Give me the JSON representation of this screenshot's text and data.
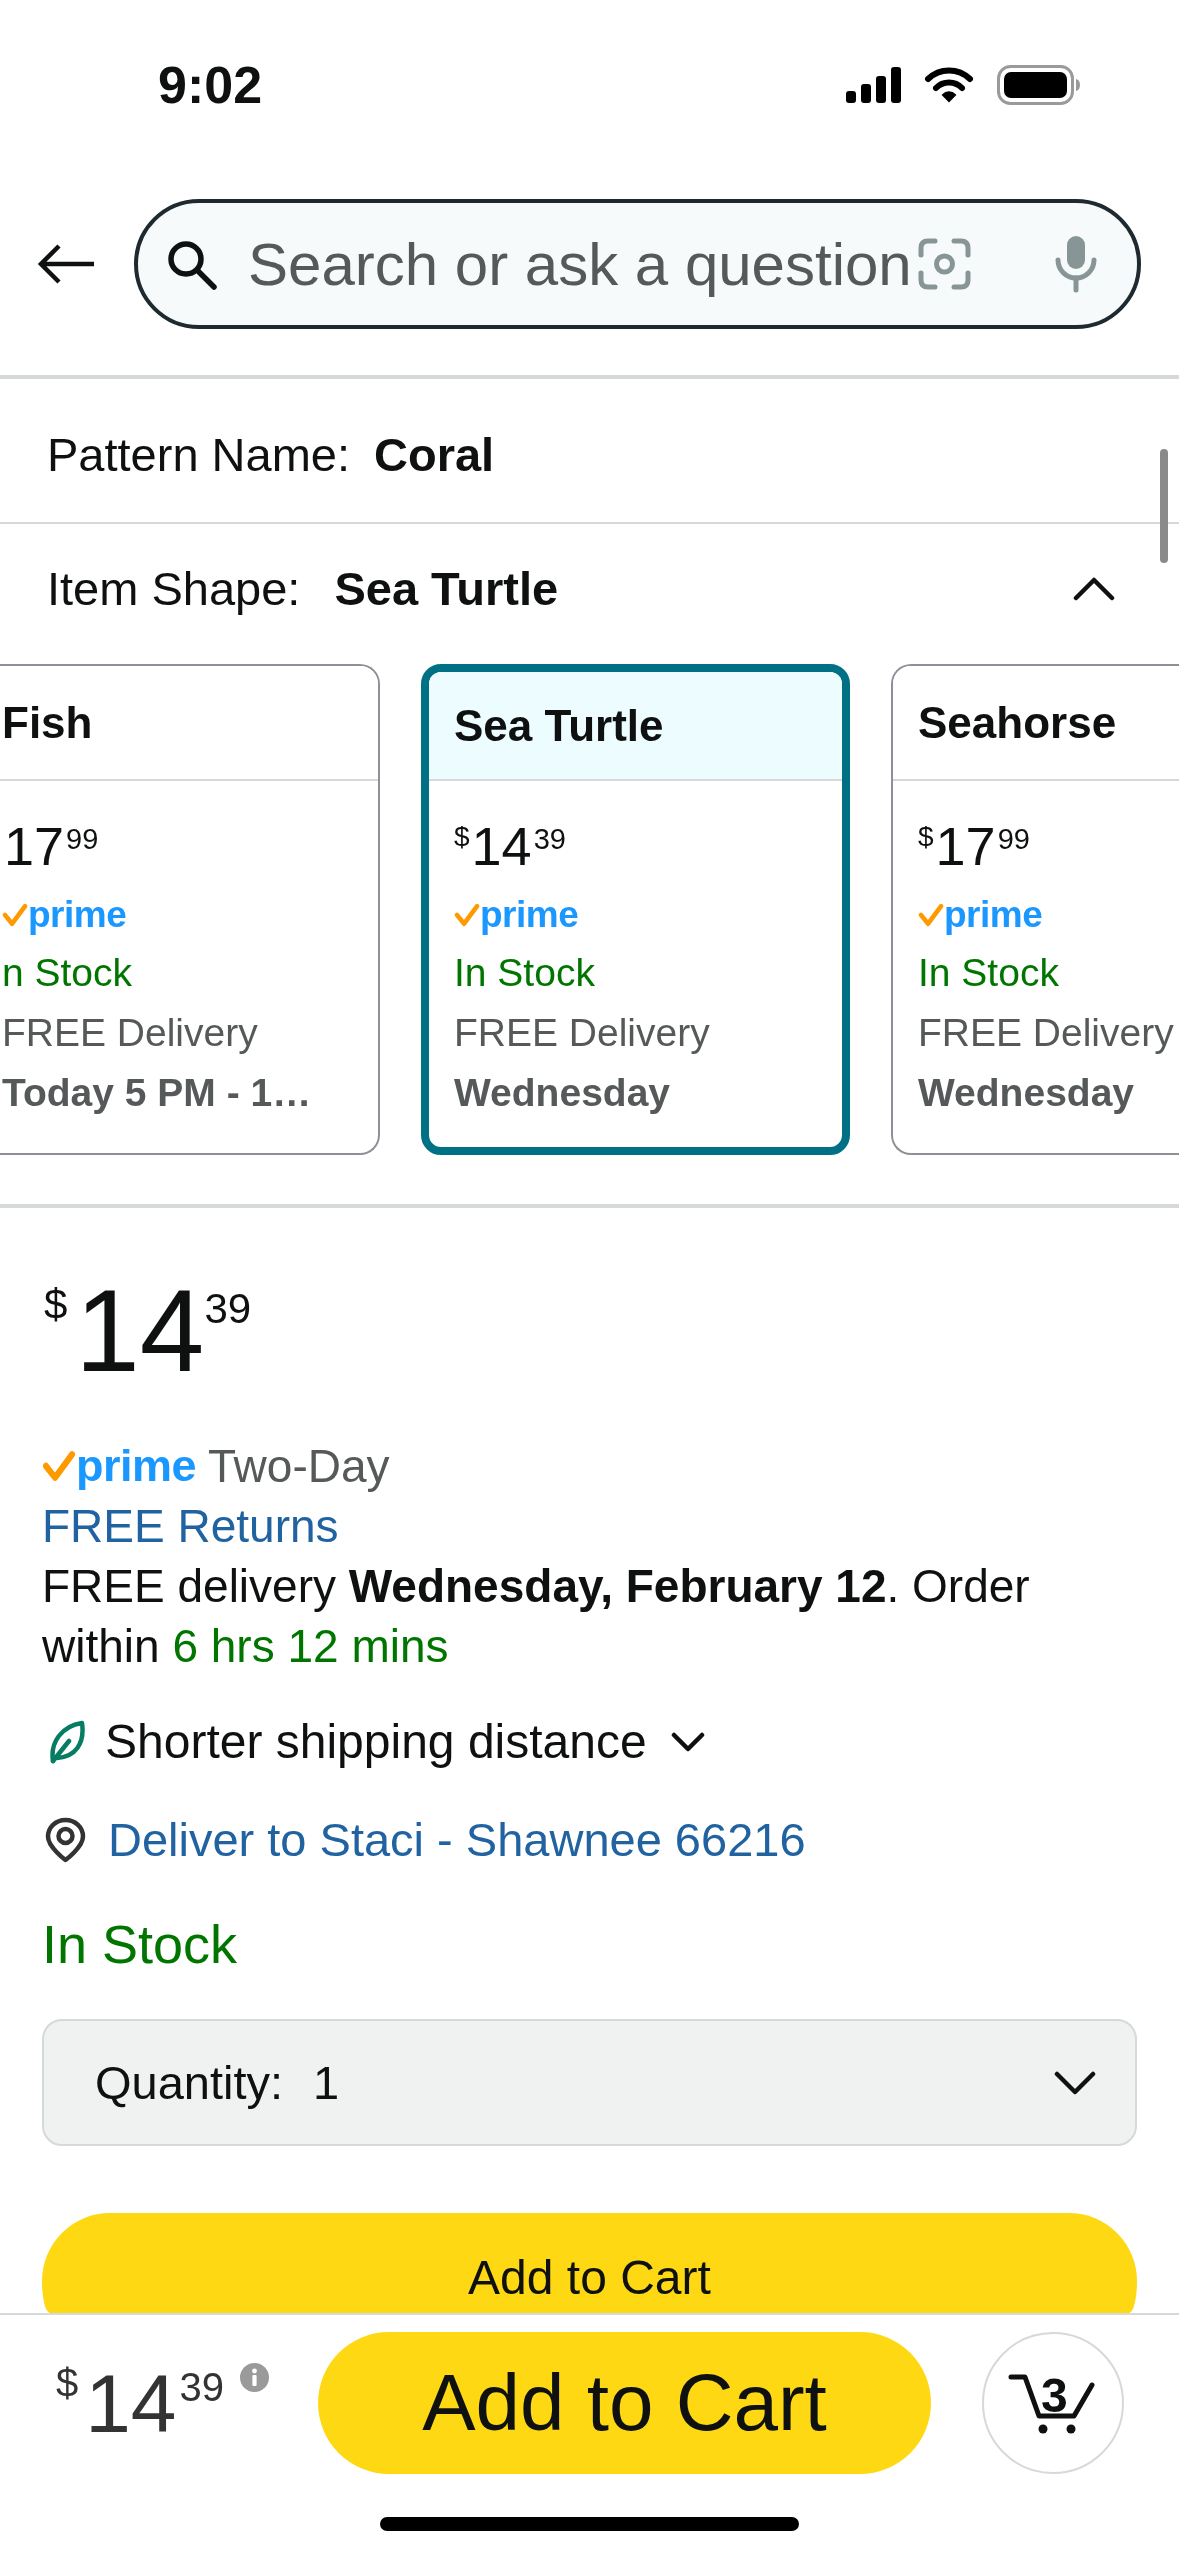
{
  "status_bar": {
    "time": "9:02"
  },
  "search": {
    "placeholder": "Search or ask a question"
  },
  "pattern": {
    "label": "Pattern Name:",
    "value": "Coral"
  },
  "item_shape": {
    "label": "Item Shape:",
    "value": "Sea Turtle",
    "expanded": true
  },
  "options": [
    {
      "name": "Fish",
      "price": {
        "whole": "17",
        "fraction": "99"
      },
      "badge": "prime",
      "availability": "n Stock",
      "delivery": "FREE Delivery",
      "date": "Today 5 PM - 1…",
      "selected": false
    },
    {
      "name": "Sea Turtle",
      "price": {
        "symbol": "$",
        "whole": "14",
        "fraction": "39"
      },
      "badge": "prime",
      "availability": "In Stock",
      "delivery": "FREE Delivery",
      "date": "Wednesday",
      "selected": true
    },
    {
      "name": "Seahorse",
      "price": {
        "symbol": "$",
        "whole": "17",
        "fraction": "99"
      },
      "badge": "prime",
      "availability": "In Stock",
      "delivery": "FREE Delivery",
      "date": "Wednesday",
      "selected": false
    }
  ],
  "price": {
    "symbol": "$",
    "whole": "14",
    "fraction": "39"
  },
  "prime_delivery": {
    "badge": "prime",
    "speed": "Two-Day"
  },
  "returns": "FREE Returns",
  "delivery_message": {
    "text": "FREE delivery **Wednesday, February 12**. Order within",
    "countdown": "6 hrs 12 mins"
  },
  "shipping_note": {
    "label": "Shorter shipping distance",
    "expanded": false
  },
  "deliver_to": "Deliver to Staci - Shawnee 66216",
  "availability": "In Stock",
  "quantity": {
    "label": "Quantity:",
    "value": "1"
  },
  "add_to_cart": "Add to Cart",
  "bottom_bar": {
    "price": {
      "symbol": "$",
      "whole": "14",
      "fraction": "39"
    },
    "button": "Add to Cart",
    "cart_count": "3"
  }
}
